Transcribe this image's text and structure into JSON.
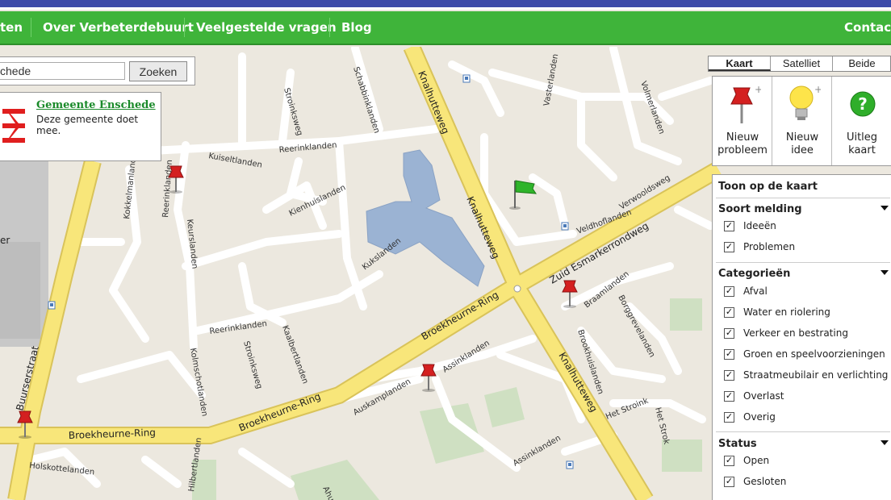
{
  "navbar": {
    "items": [
      "ten",
      "Over Verbeterdebuurt",
      "Veelgestelde vragen",
      "Blog"
    ],
    "contact": "Contact"
  },
  "search": {
    "value": "chede",
    "button": "Zoeken"
  },
  "municipality": {
    "name": "Gemeente Enschede",
    "description": "Deze gemeente doet mee."
  },
  "map_types": {
    "kaart": "Kaart",
    "satelliet": "Satelliet",
    "beide": "Beide",
    "selected": "Kaart"
  },
  "actions": {
    "new_problem": [
      "Nieuw",
      "probleem"
    ],
    "new_idea": [
      "Nieuw",
      "idee"
    ],
    "map_help": [
      "Uitleg",
      "kaart"
    ]
  },
  "filters": {
    "title": "Toon op de kaart",
    "soort": {
      "title": "Soort melding",
      "items": [
        "Ideeën",
        "Problemen"
      ]
    },
    "categorieen": {
      "title": "Categorieën",
      "items": [
        "Afval",
        "Water en riolering",
        "Verkeer en bestrating",
        "Groen en speelvoorzieningen",
        "Straatmeubilair en verlichting",
        "Overlast",
        "Overig"
      ]
    },
    "status": {
      "title": "Status",
      "items": [
        "Open",
        "Gesloten"
      ]
    }
  },
  "map_labels": {
    "broekheurne1": "Broekheurne-Ring",
    "broekheurne2": "Broekheurne-Ring",
    "broekheurne3": "Broekheurne-Ring",
    "zuid_esmarker": "Zuid Esmarkerrondweg",
    "knalhutteweg1": "Knalhutteweg",
    "knalhutteweg2": "Knalhutteweg",
    "knalhutteweg3": "Knalhutteweg",
    "buurserstraat": "Buurserstraat",
    "reerinklanden1": "Reerinklanden",
    "reerinklanden2": "Reerinklanden",
    "reerinklanden3": "Reerinklanden",
    "kukslanden": "Kukslanden",
    "kaalbertlanden": "Kaalbertlanden",
    "assinklanden1": "Assinklanden",
    "assinklanden2": "Assinklanden",
    "auskamplanden": "Auskamplanden",
    "brookhuislanden": "Brookhuislanden",
    "borggrevelanden": "Borggrevelanden",
    "braamlanden": "Braamlanden",
    "het_stroink": "Het Stroink",
    "veldhoflanden": "Veldhoflanden",
    "verwooldsweg": "Verwooldsweg",
    "vasterlanden": "Vasterlanden",
    "volmerlanden": "Volmerlanden",
    "schabbinklanden": "Schabbinklanden",
    "stroinksweg1": "Stroinksweg",
    "stroinksweg2": "Stroinksweg",
    "kienhuislanden": "Kienhuislanden",
    "kuiseltlanden": "Kuiseltlanden",
    "keurslanden": "Keurslanden",
    "kokkelmanlanden": "Kokkelmanlanden",
    "kolmschotlanden": "Kolmschotlanden",
    "holskottelanden": "Holskottelanden",
    "hilbertlanden": "Hilbertlanden",
    "ahuisl": "Ahuisl",
    "er": "er",
    "het_strok": "Het Strok"
  },
  "colors": {
    "nav": "#3fb43a",
    "road_main": "#f8e67a",
    "road_minor": "#ffffff",
    "water": "#9bb3d3",
    "pin": "#d42020"
  }
}
